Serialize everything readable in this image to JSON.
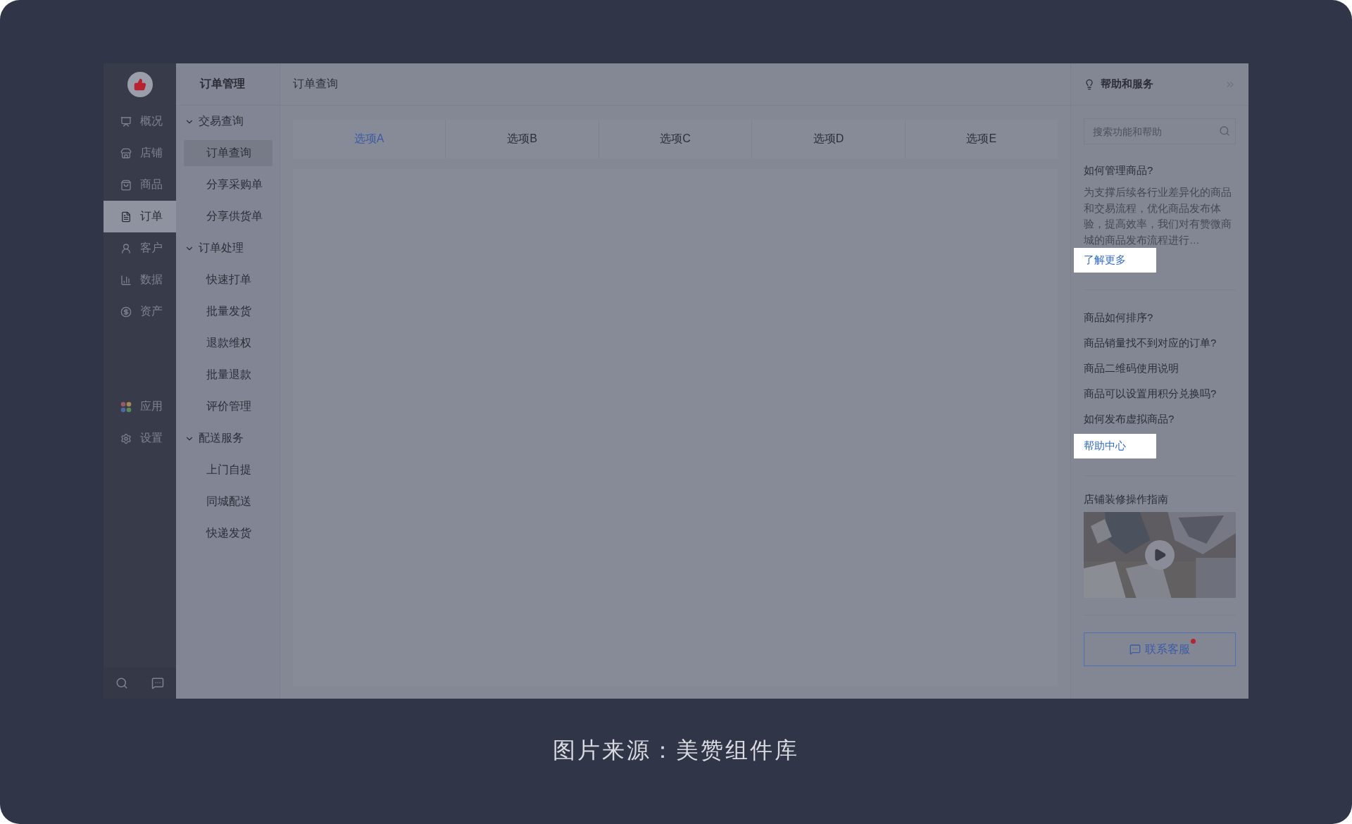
{
  "sidebar": {
    "items": [
      {
        "label": "概况",
        "selected": false
      },
      {
        "label": "店铺",
        "selected": false
      },
      {
        "label": "商品",
        "selected": false
      },
      {
        "label": "订单",
        "selected": true
      },
      {
        "label": "客户",
        "selected": false
      },
      {
        "label": "数据",
        "selected": false
      },
      {
        "label": "资产",
        "selected": false
      }
    ],
    "extra_items": [
      {
        "label": "应用",
        "selected": false
      },
      {
        "label": "设置",
        "selected": false
      }
    ]
  },
  "subnav": {
    "title": "订单管理",
    "groups": [
      {
        "label": "交易查询",
        "expanded": true,
        "children": [
          {
            "label": "订单查询",
            "selected": true
          },
          {
            "label": "分享采购单",
            "selected": false
          },
          {
            "label": "分享供货单",
            "selected": false
          }
        ]
      },
      {
        "label": "订单处理",
        "expanded": true,
        "children": [
          {
            "label": "快速打单",
            "selected": false
          },
          {
            "label": "批量发货",
            "selected": false
          },
          {
            "label": "退款维权",
            "selected": false
          },
          {
            "label": "批量退款",
            "selected": false
          },
          {
            "label": "评价管理",
            "selected": false
          }
        ]
      },
      {
        "label": "配送服务",
        "expanded": true,
        "children": [
          {
            "label": "上门自提",
            "selected": false
          },
          {
            "label": "同城配送",
            "selected": false
          },
          {
            "label": "快递发货",
            "selected": false
          }
        ]
      }
    ]
  },
  "main": {
    "breadcrumb": "订单查询",
    "tabs": [
      {
        "label": "选项A",
        "selected": true
      },
      {
        "label": "选项B",
        "selected": false
      },
      {
        "label": "选项C",
        "selected": false
      },
      {
        "label": "选项D",
        "selected": false
      },
      {
        "label": "选项E",
        "selected": false
      }
    ]
  },
  "help_panel": {
    "title": "帮助和服务",
    "search": {
      "placeholder": "搜索功能和帮助"
    },
    "article": {
      "title": "如何管理商品?",
      "summary": "为支撑后续各行业差异化的商品和交易流程，优化商品发布体验，提高效率，我们对有赞微商城的商品发布流程进行…",
      "link": {
        "label": "了解更多",
        "highlighted": true
      }
    },
    "questions": [
      "商品如何排序?",
      "商品销量找不到对应的订单?",
      "商品二维码使用说明",
      "商品可以设置用积分兑换吗?",
      "如何发布虚拟商品?"
    ],
    "help_link": {
      "label": "帮助中心",
      "highlighted": true
    },
    "video": {
      "title": "店铺装修操作指南",
      "kind": "picture"
    },
    "contact_button": {
      "label": "联系客服",
      "badge": true
    }
  },
  "caption": "图片来源：美赞组件库"
}
